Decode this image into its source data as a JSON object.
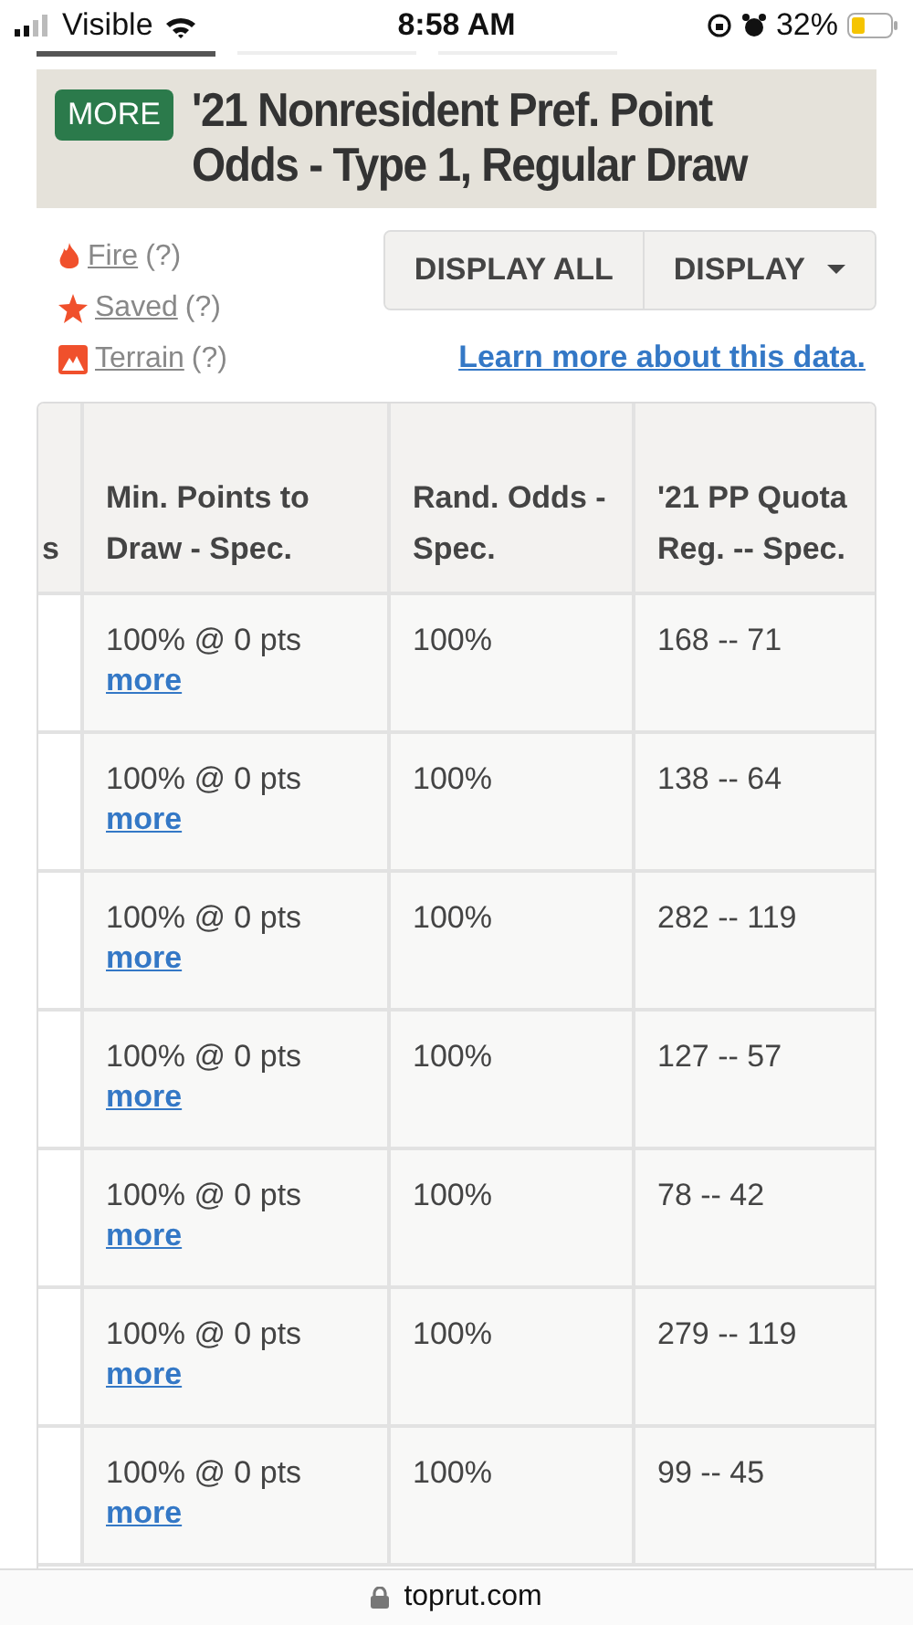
{
  "status_bar": {
    "carrier": "Visible",
    "time": "8:58 AM",
    "battery": "32%"
  },
  "browser_tabs": [
    {
      "selected": true
    },
    {
      "selected": false
    },
    {
      "selected": false
    }
  ],
  "header": {
    "badge": "MORE",
    "title": "'21 Nonresident Pref. Point Odds - Type 1, Regular Draw"
  },
  "legend": [
    {
      "kind": "fire",
      "label": "Fire",
      "hint": "(?)"
    },
    {
      "kind": "star",
      "label": "Saved",
      "hint": "(?)"
    },
    {
      "kind": "terrain",
      "label": "Terrain",
      "hint": "(?)"
    }
  ],
  "buttons": [
    {
      "label": "DISPLAY ALL",
      "dropdown": false
    },
    {
      "label": "DISPLAY",
      "dropdown": true
    }
  ],
  "learn_link": "Learn more about this data.",
  "table": {
    "columns": [
      "s",
      "Min. Points to Draw - Spec.",
      "Rand. Odds - Spec.",
      "'21 PP Quota Reg. -- Spec."
    ],
    "rows": [
      {
        "min_points": "100% @ 0 pts",
        "link": "more",
        "rand_odds": "100%",
        "quota": "168 -- 71"
      },
      {
        "min_points": "100% @ 0 pts",
        "link": "more",
        "rand_odds": "100%",
        "quota": "138 -- 64"
      },
      {
        "min_points": "100% @ 0 pts",
        "link": "more",
        "rand_odds": "100%",
        "quota": "282 -- 119"
      },
      {
        "min_points": "100% @ 0 pts",
        "link": "more",
        "rand_odds": "100%",
        "quota": "127 -- 57"
      },
      {
        "min_points": "100% @ 0 pts",
        "link": "more",
        "rand_odds": "100%",
        "quota": "78 -- 42"
      },
      {
        "min_points": "100% @ 0 pts",
        "link": "more",
        "rand_odds": "100%",
        "quota": "279 -- 119"
      },
      {
        "min_points": "100% @ 0 pts",
        "link": "more",
        "rand_odds": "100%",
        "quota": "99 -- 45"
      }
    ]
  },
  "address_bar": {
    "domain": "toprut.com"
  }
}
